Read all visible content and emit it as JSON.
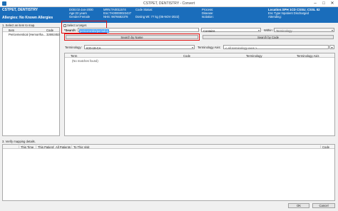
{
  "window": {
    "title": "CSTPET, DENTISTRY - Convert",
    "min": "–",
    "max": "□",
    "close": "✕"
  },
  "banner": {
    "name": "CSTPET, DENTISTRY",
    "allergies": "Allergies: No Known Allergies",
    "dob": "DOB:02-Jan-2000",
    "age": "Age:22 years",
    "gender": "Gender:Female",
    "mrn": "MRN:TA0011574",
    "enc": "Enc:TA00000022437",
    "nhs": "NHS: 9876682378",
    "code_status": "Code Status:",
    "dosing_wt": "Dosing Wt: 77 kg (05-NOV-2022)",
    "process": "Process:",
    "disease": "Disease:",
    "isolation": "Isolation:",
    "location": "Location:SPH 1CD CSSU; CSSL 02",
    "enc_type": "Enc Type:Inpatient  Discharged",
    "attending": "Attending:"
  },
  "left_panel": {
    "label": "1. Select an item to map.",
    "columns": [
      "Item",
      "Code"
    ],
    "rows": [
      {
        "item": "Pericementical (Hemorrha...",
        "code": "32692453"
      }
    ]
  },
  "target": {
    "checkbox_label": "Select a target.",
    "search_label": "*Search:",
    "search_value": "pericoronitis/periodon",
    "match_mode": "Contains",
    "within_label": "Within:",
    "within_value": "Terminology",
    "search_by_name": "Search by Name",
    "search_by_code": "Search by Code",
    "terminology_label": "Terminology:",
    "terminology_value": "ICD-10-CA",
    "terminology_axis_label": "Terminology Axis:",
    "terminology_axis_value": "< All terminology axes >",
    "columns": [
      "Term",
      "Code",
      "Terminology",
      "Terminology Axis"
    ],
    "no_matches": "(No matches found)"
  },
  "verify": {
    "label": "3. Verify mapping details.",
    "columns": [
      "This Time",
      "This Patient",
      "All Patients",
      "To This Visit",
      "Code"
    ]
  },
  "footer": {
    "ok": "OK",
    "cancel": "Cancel"
  }
}
